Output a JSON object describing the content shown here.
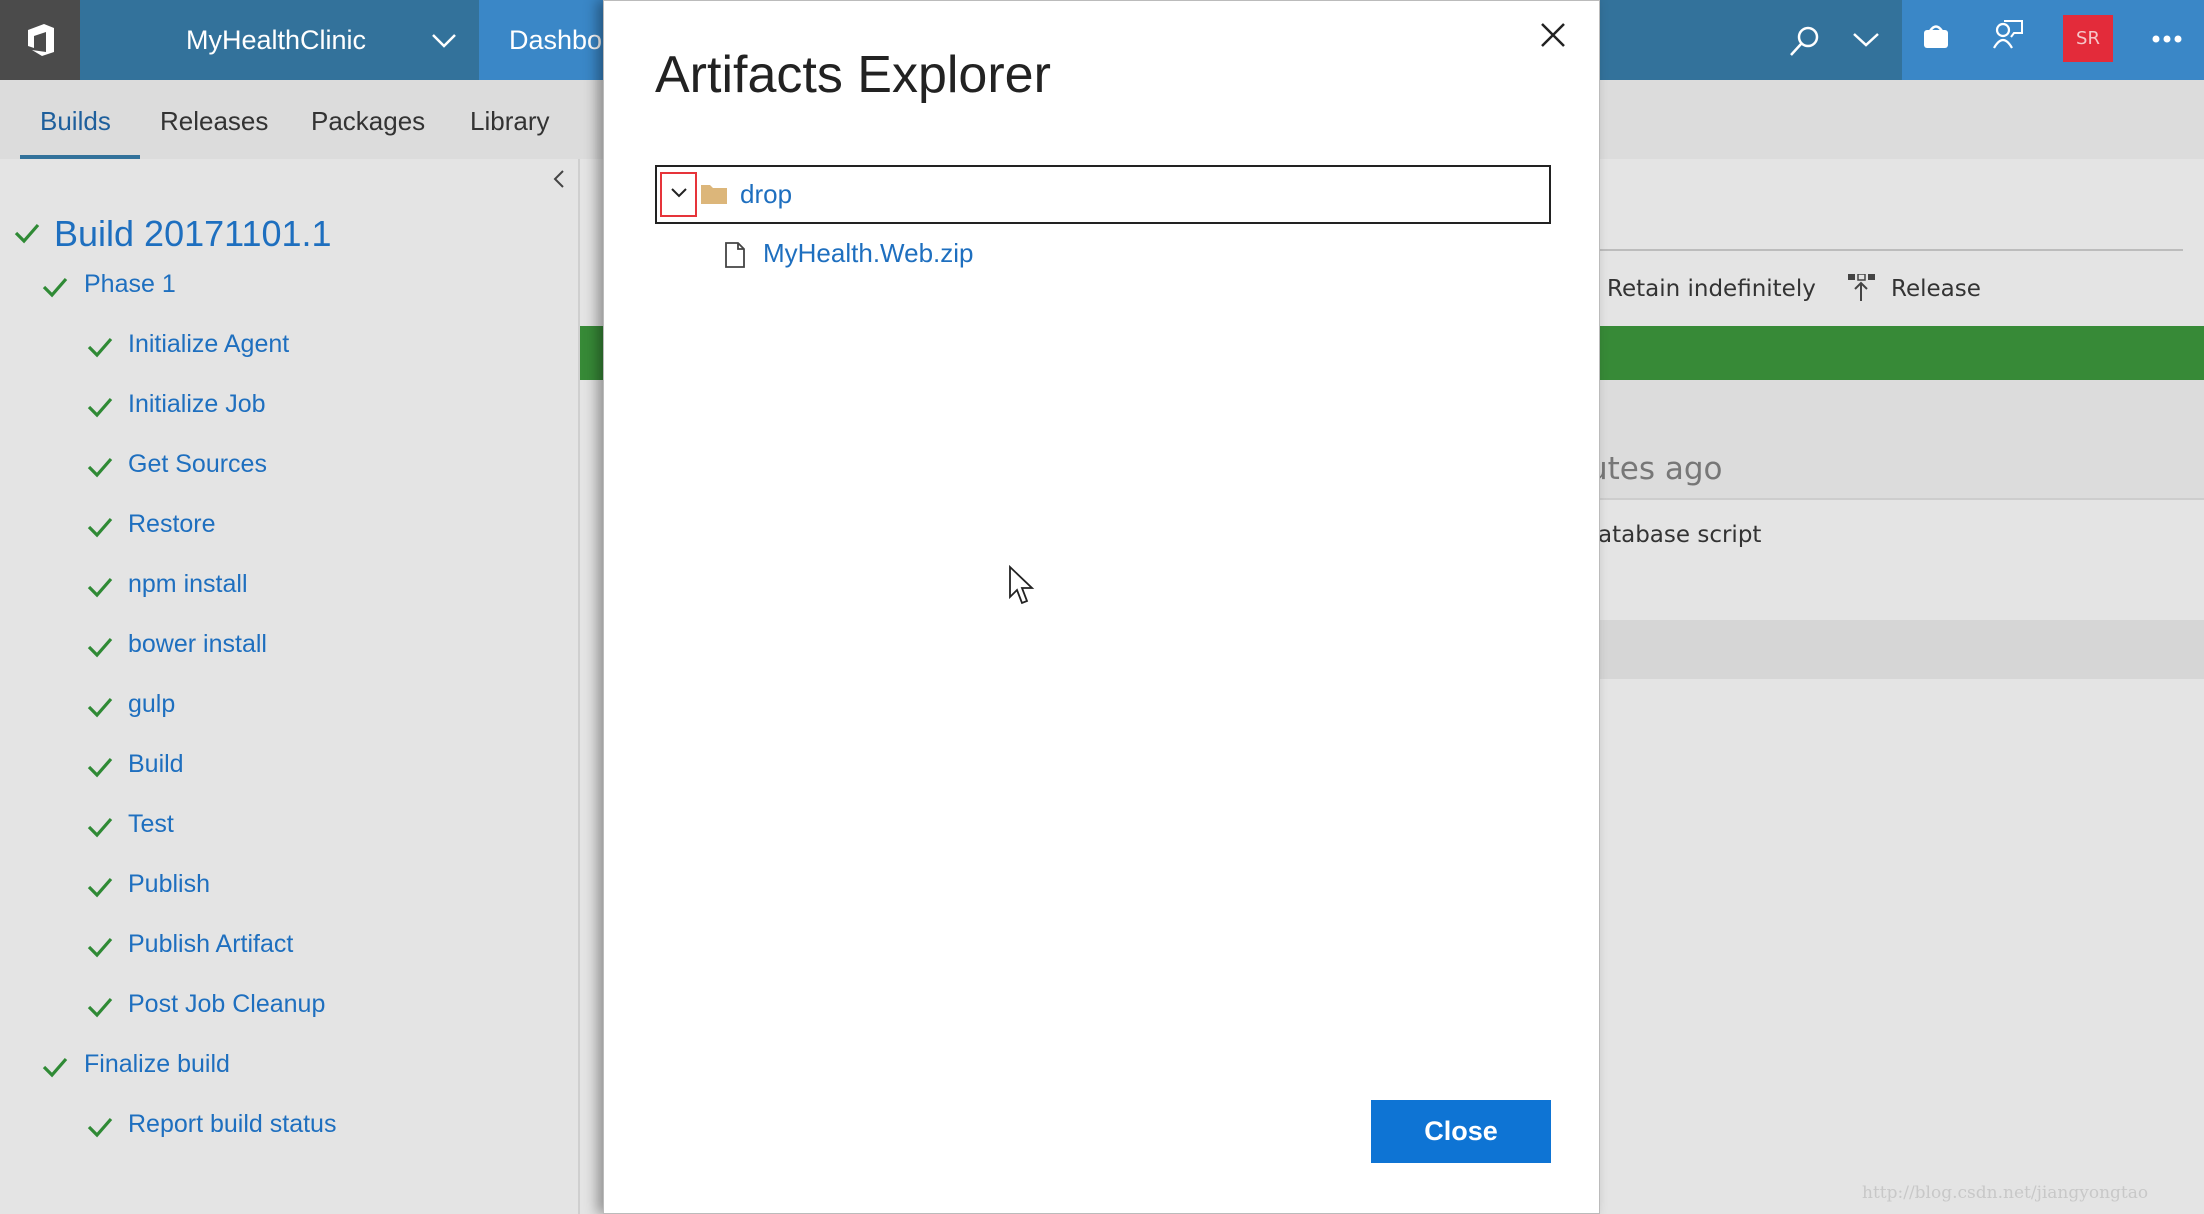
{
  "header": {
    "project": "MyHealthClinic",
    "dashboard_partial": "Dashbo",
    "avatar_initials": "SR"
  },
  "tabs": [
    {
      "label": "Builds",
      "active": true
    },
    {
      "label": "Releases"
    },
    {
      "label": "Packages"
    },
    {
      "label": "Library"
    }
  ],
  "build": {
    "title": "Build 20171101.1",
    "phases": [
      {
        "label": "Phase 1",
        "steps": [
          "Initialize Agent",
          "Initialize Job",
          "Get Sources",
          "Restore",
          "npm install",
          "bower install",
          "gulp",
          "Build",
          "Test",
          "Publish",
          "Publish Artifact",
          "Post Job Cleanup"
        ]
      },
      {
        "label": "Finalize build",
        "steps": [
          "Report build status"
        ]
      }
    ]
  },
  "summary": {
    "retain_label": "Retain indefinitely",
    "release_label": "Release",
    "time_partial": "utes ago",
    "commit_partial": "atabase script",
    "status_color": "#378a37"
  },
  "dialog": {
    "title": "Artifacts Explorer",
    "folder": "drop",
    "file": "MyHealth.Web.zip",
    "close_label": "Close"
  },
  "watermark": "http://blog.csdn.net/jiangyongtao"
}
